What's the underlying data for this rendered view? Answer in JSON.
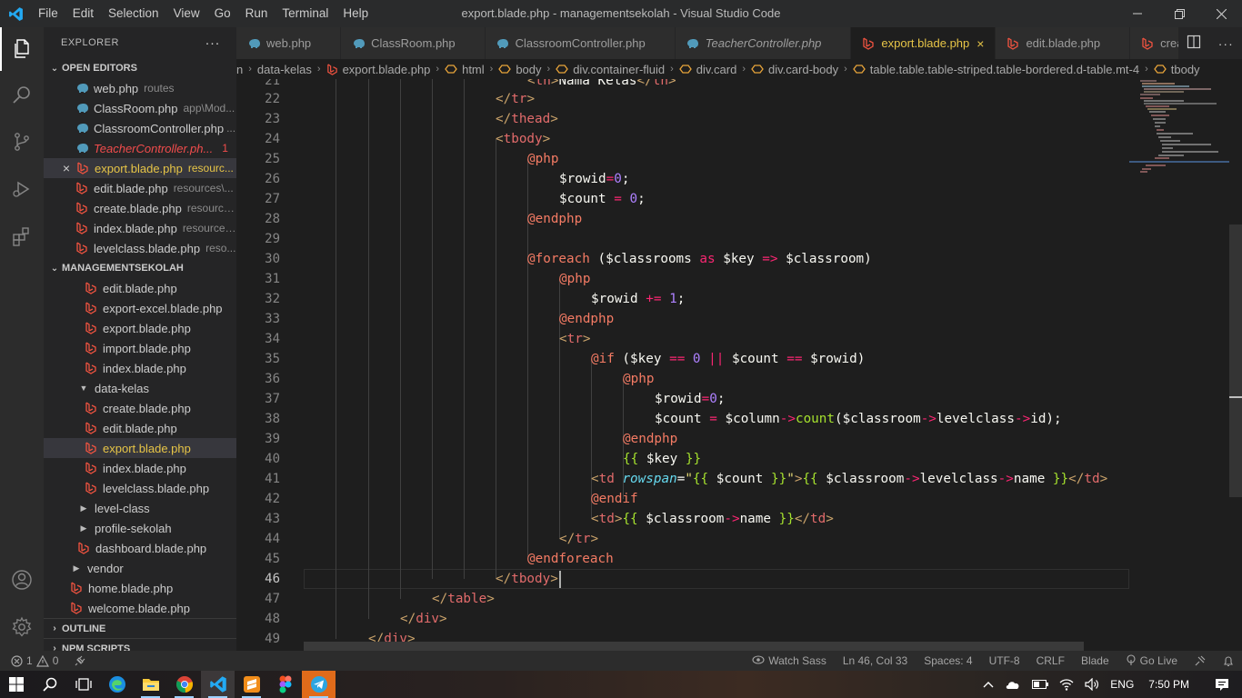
{
  "titlebar": {
    "menu": [
      "File",
      "Edit",
      "Selection",
      "View",
      "Go",
      "Run",
      "Terminal",
      "Help"
    ],
    "window_title": "export.blade.php - managementsekolah - Visual Studio Code"
  },
  "sidebar": {
    "title": "EXPLORER",
    "more": "···",
    "open_editors_label": "OPEN EDITORS",
    "open_editors": [
      {
        "name": "web.php",
        "desc": "routes",
        "icon": "php-icon"
      },
      {
        "name": "ClassRoom.php",
        "desc": "app\\Mod...",
        "icon": "php-icon"
      },
      {
        "name": "ClassroomController.php",
        "desc": "...",
        "icon": "php-icon"
      },
      {
        "name": "TeacherController.ph...",
        "desc": "1",
        "icon": "php-icon"
      },
      {
        "name": "export.blade.php",
        "desc": "resourc...",
        "icon": "laravel-icon"
      },
      {
        "name": "edit.blade.php",
        "desc": "resources\\...",
        "icon": "laravel-icon"
      },
      {
        "name": "create.blade.php",
        "desc": "resource...",
        "icon": "laravel-icon"
      },
      {
        "name": "index.blade.php",
        "desc": "resources...",
        "icon": "laravel-icon"
      },
      {
        "name": "levelclass.blade.php",
        "desc": "reso...",
        "icon": "laravel-icon"
      }
    ],
    "project_label": "MANAGEMENTSEKOLAH",
    "tree": [
      {
        "name": "edit.blade.php"
      },
      {
        "name": "export-excel.blade.php"
      },
      {
        "name": "export.blade.php"
      },
      {
        "name": "import.blade.php"
      },
      {
        "name": "index.blade.php"
      },
      {
        "name": "data-kelas"
      },
      {
        "name": "create.blade.php"
      },
      {
        "name": "edit.blade.php"
      },
      {
        "name": "export.blade.php"
      },
      {
        "name": "index.blade.php"
      },
      {
        "name": "levelclass.blade.php"
      },
      {
        "name": "level-class"
      },
      {
        "name": "profile-sekolah"
      },
      {
        "name": "dashboard.blade.php"
      },
      {
        "name": "vendor"
      },
      {
        "name": "home.blade.php"
      },
      {
        "name": "welcome.blade.php"
      }
    ],
    "outline_label": "OUTLINE",
    "npm_label": "NPM SCRIPTS"
  },
  "tabs": [
    {
      "name": "web.php"
    },
    {
      "name": "ClassRoom.php"
    },
    {
      "name": "ClassroomController.php"
    },
    {
      "name": "TeacherController.php"
    },
    {
      "name": "export.blade.php",
      "close": "×"
    },
    {
      "name": "edit.blade.php"
    },
    {
      "name": "create.l"
    }
  ],
  "breadcrumb": [
    "n",
    "data-kelas",
    "export.blade.php",
    "html",
    "body",
    "div.container-fluid",
    "div.card",
    "div.card-body",
    "table.table.table-striped.table-bordered.d-table.mt-4",
    "tbody"
  ],
  "editor": {
    "line_numbers": [
      "21",
      "22",
      "23",
      "24",
      "25",
      "26",
      "27",
      "28",
      "29",
      "30",
      "31",
      "32",
      "33",
      "34",
      "35",
      "36",
      "37",
      "38",
      "39",
      "40",
      "41",
      "42",
      "43",
      "44",
      "45",
      "46",
      "47",
      "48",
      "49"
    ],
    "current_line": "46"
  },
  "statusbar": {
    "errors": "1",
    "warnings": "0",
    "watch_sass": "Watch Sass",
    "position": "Ln 46, Col 33",
    "spaces": "Spaces: 4",
    "encoding": "UTF-8",
    "eol": "CRLF",
    "language": "Blade",
    "go_live": "Go Live"
  },
  "taskbar": {
    "lang": "ENG",
    "time": "7:50 PM"
  },
  "colors": {
    "accent_blue": "#0078d4",
    "vscode_blue": "#23a9f2",
    "laravel_red": "#f05340",
    "php_blue": "#519aba",
    "modified_text": "#e7c547",
    "error_text": "#f14c4c"
  }
}
